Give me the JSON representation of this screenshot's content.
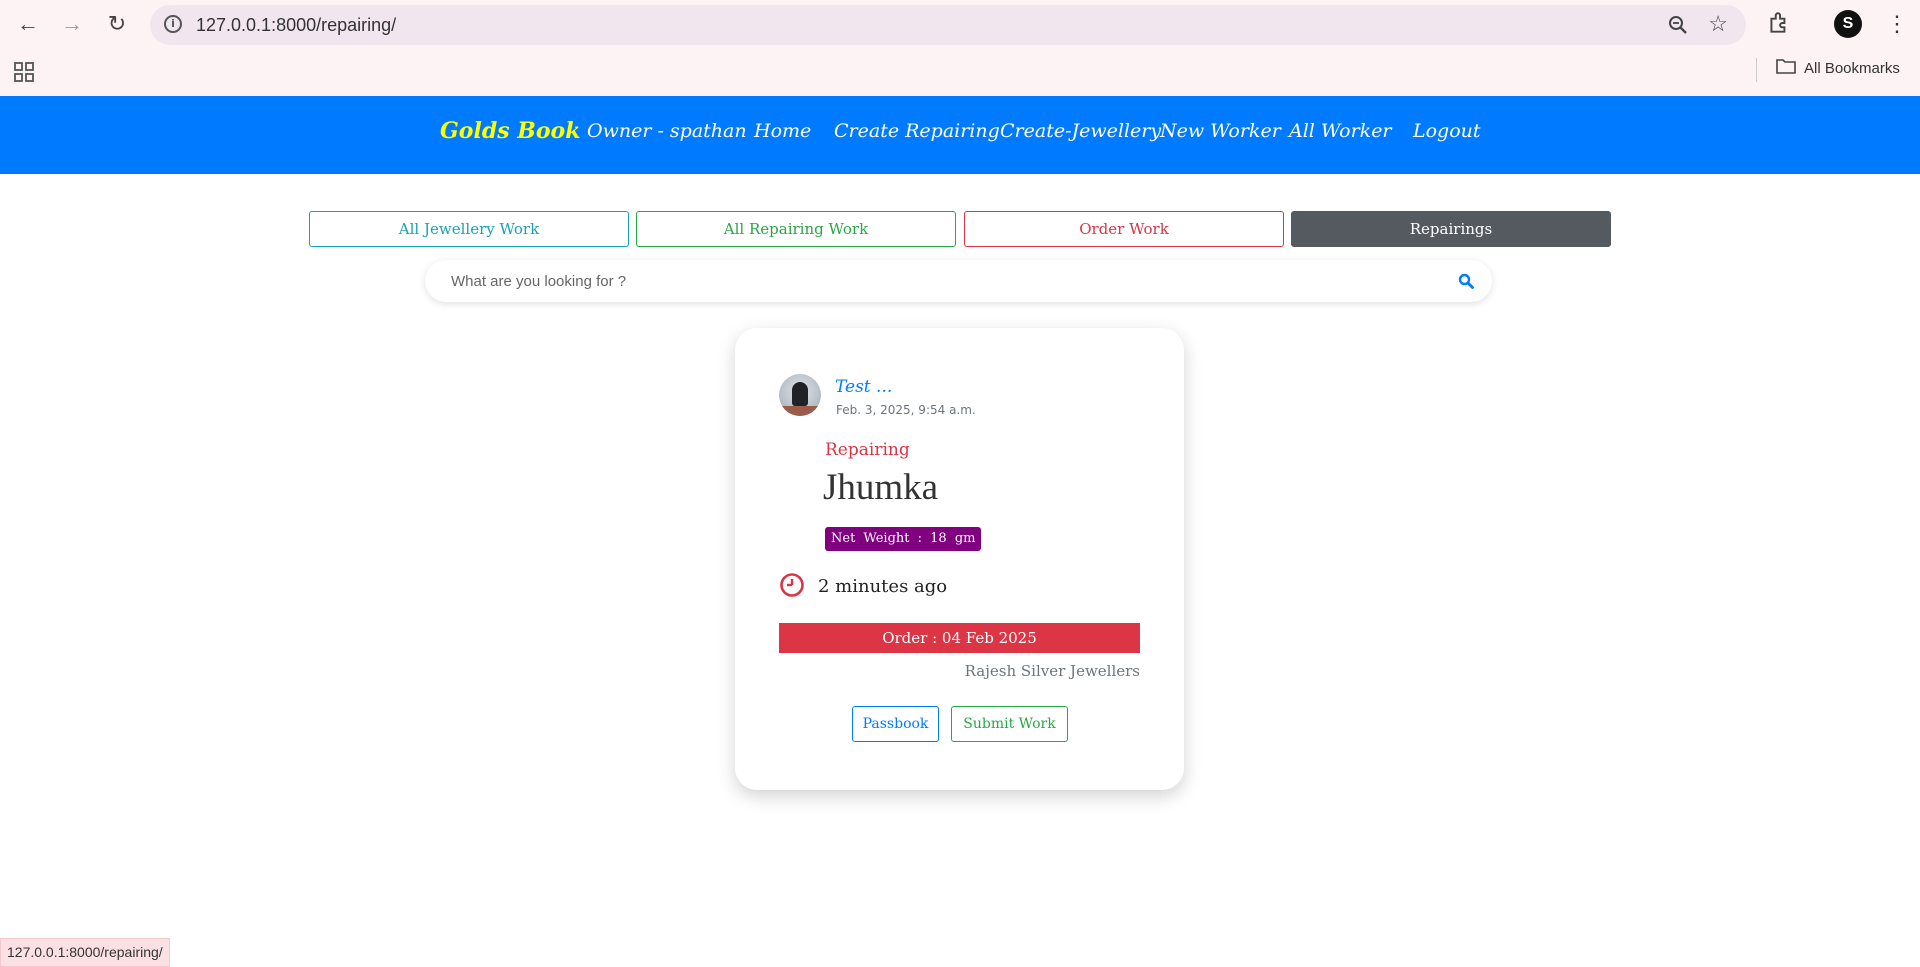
{
  "browser": {
    "url": "127.0.0.1:8000/repairing/",
    "bookmarks_label": "All Bookmarks",
    "profile_initial": "S",
    "status_url": "127.0.0.1:8000/repairing/"
  },
  "nav": {
    "brand": "Golds Book",
    "items": [
      "Owner - spathan",
      "Home",
      "Create Repairing",
      "Create-Jewellery",
      "New Worker",
      "All Worker",
      "Logout"
    ],
    "background": "#007bff",
    "brand_color": "#ffff00"
  },
  "tabs": [
    "All Jewellery Work",
    "All Repairing Work",
    "Order Work",
    "Repairings"
  ],
  "search": {
    "placeholder": "What are you looking for ?"
  },
  "card": {
    "user": "Test ...",
    "date": "Feb. 3, 2025, 9:54 a.m.",
    "work_type": "Repairing",
    "item_name": "Jhumka",
    "net_weight": "Net Weight : 18 gm",
    "time_ago": "2 minutes ago",
    "order": "Order : 04 Feb 2025",
    "shop": "Rajesh Silver Jewellers",
    "passbook_label": "Passbook",
    "submit_label": "Submit Work"
  },
  "colors": {
    "info": "#17a2b8",
    "success": "#28a745",
    "danger": "#dc3545",
    "secondary": "#555a60",
    "badge": "#800080"
  }
}
